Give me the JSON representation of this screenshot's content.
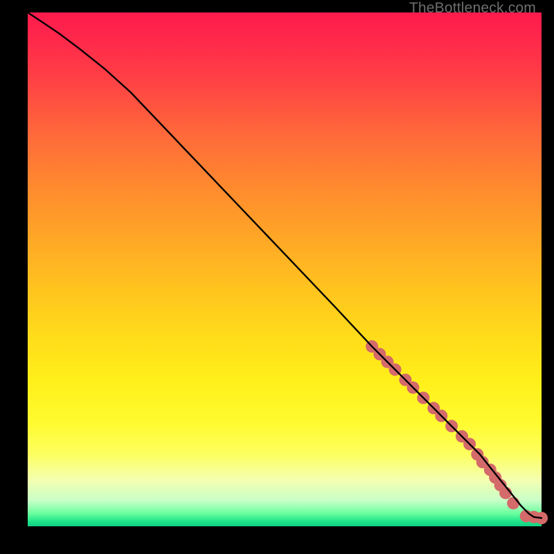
{
  "watermark": "TheBottleneck.com",
  "chart_data": {
    "type": "line",
    "title": "",
    "xlabel": "",
    "ylabel": "",
    "xlim": [
      0,
      100
    ],
    "ylim": [
      0,
      100
    ],
    "grid": false,
    "series": [
      {
        "name": "curve",
        "color": "#000000",
        "x": [
          0,
          3,
          6,
          10,
          15,
          20,
          30,
          40,
          50,
          60,
          67,
          70,
          73,
          76,
          79,
          82,
          85,
          88,
          90,
          92,
          94,
          96,
          97.5,
          98.5,
          100
        ],
        "y": [
          100,
          98,
          96,
          93,
          89,
          84.5,
          74,
          63.5,
          53,
          42.5,
          35,
          32,
          29,
          26,
          23,
          20,
          17,
          14,
          11.5,
          9,
          6.5,
          4,
          2.5,
          1.8,
          1.6
        ]
      }
    ],
    "markers": [
      {
        "name": "highlight-dots",
        "color": "#d46a6a",
        "r": 9,
        "points": [
          {
            "x": 67.0,
            "y": 35.0
          },
          {
            "x": 68.5,
            "y": 33.5
          },
          {
            "x": 70.0,
            "y": 32.0
          },
          {
            "x": 71.5,
            "y": 30.5
          },
          {
            "x": 73.5,
            "y": 28.5
          },
          {
            "x": 75.0,
            "y": 27.0
          },
          {
            "x": 77.0,
            "y": 25.0
          },
          {
            "x": 79.0,
            "y": 23.0
          },
          {
            "x": 80.5,
            "y": 21.5
          },
          {
            "x": 82.5,
            "y": 19.5
          },
          {
            "x": 84.5,
            "y": 17.5
          },
          {
            "x": 86.0,
            "y": 16.0
          },
          {
            "x": 87.5,
            "y": 14.0
          },
          {
            "x": 88.5,
            "y": 12.5
          },
          {
            "x": 90.0,
            "y": 11.0
          },
          {
            "x": 91.0,
            "y": 9.5
          },
          {
            "x": 92.0,
            "y": 8.0
          },
          {
            "x": 93.0,
            "y": 6.5
          },
          {
            "x": 94.5,
            "y": 4.5
          },
          {
            "x": 97.0,
            "y": 2.0
          },
          {
            "x": 98.5,
            "y": 1.8
          },
          {
            "x": 100.0,
            "y": 1.6
          }
        ]
      }
    ]
  }
}
